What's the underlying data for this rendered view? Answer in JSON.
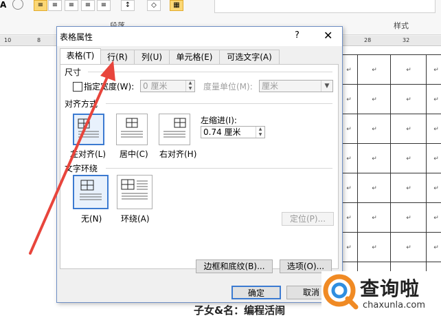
{
  "ribbon": {
    "align_left_label": "A",
    "paragraph_group": "段落",
    "styles_group": "样式",
    "line_spacing_icon": "↕",
    "shading_icon": "◇",
    "border_icon": "▦"
  },
  "ruler": {
    "marks": [
      "10",
      "8",
      "28",
      "32"
    ]
  },
  "table_mark": "↵",
  "dialog": {
    "title": "表格属性",
    "help": "?",
    "close": "✕",
    "tabs": [
      "表格(T)",
      "行(R)",
      "列(U)",
      "单元格(E)",
      "可选文字(A)"
    ],
    "size_section": "尺寸",
    "specify_width": "指定宽度(W):",
    "width_value": "0 厘米",
    "measure_in": "度量单位(M):",
    "measure_value": "厘米",
    "alignment_section": "对齐方式",
    "align_left": "左对齐(L)",
    "align_center": "居中(C)",
    "align_right": "右对齐(H)",
    "indent_label": "左缩进(I):",
    "indent_value": "0.74 厘米",
    "wrap_section": "文字环绕",
    "wrap_none": "无(N)",
    "wrap_around": "环绕(A)",
    "position_button": "定位(P)...",
    "borders_button": "边框和底纹(B)...",
    "options_button": "选项(O)...",
    "ok_button": "确定",
    "cancel_button": "取消"
  },
  "bottom_text": "子女&名：编程活闹",
  "watermark": {
    "brand": "查询啦",
    "url": "chaxunla.com",
    "accent": "#f08a24",
    "blue": "#2f8ee0"
  },
  "annotation": {
    "color": "#e8453c"
  }
}
